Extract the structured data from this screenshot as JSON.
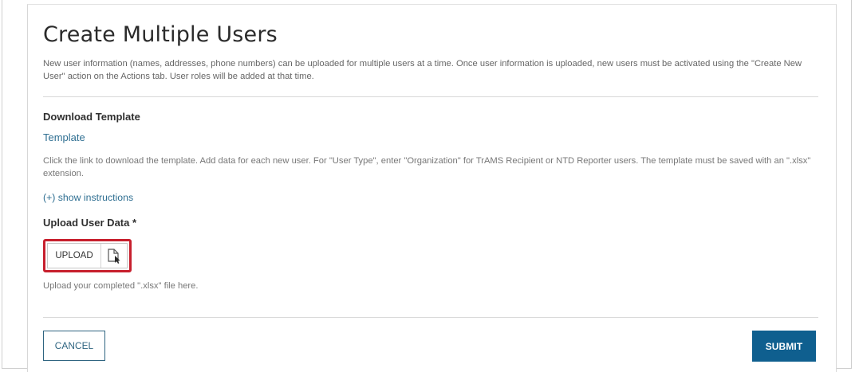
{
  "page": {
    "title": "Create Multiple Users",
    "intro": "New user information (names, addresses, phone numbers) can be uploaded for multiple users at a time. Once user information is uploaded, new users must be activated using the \"Create New User\" action on the Actions tab. User roles will be added at that time."
  },
  "download_template": {
    "heading": "Download Template",
    "link_label": "Template",
    "helper_text": "Click the link to download the template. Add data for each new user. For \"User Type\", enter \"Organization\" for TrAMS Recipient or NTD Reporter users. The template must be saved with an \".xlsx\" extension.",
    "instructions_toggle": "(+) show instructions"
  },
  "upload_user_data": {
    "heading": "Upload User Data *",
    "button_label": "UPLOAD",
    "icon": "file-upload-icon",
    "helper_text": "Upload your completed \".xlsx\" file here."
  },
  "actions": {
    "cancel_label": "CANCEL",
    "submit_label": "SUBMIT"
  },
  "colors": {
    "accent": "#0f5f8f",
    "link": "#2f6f92",
    "highlight": "#c71f2d"
  }
}
